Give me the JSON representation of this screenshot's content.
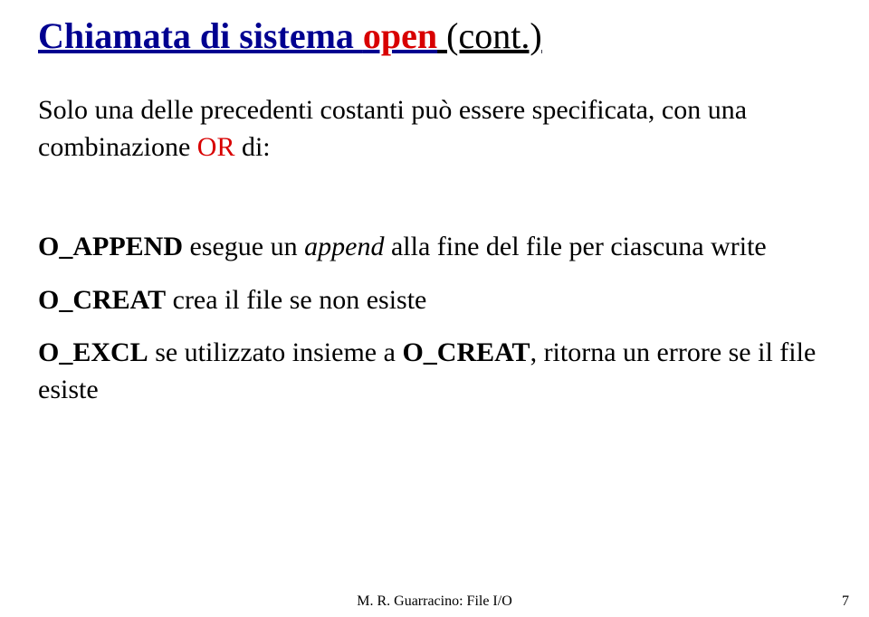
{
  "title": {
    "part1": "Chiamata di sistema ",
    "highlight": "open",
    "part2": " (cont.)"
  },
  "lead": {
    "t1": "Solo una delle precedenti costanti può essere specificata, con una combinazione ",
    "or": "OR",
    "t2": " di:"
  },
  "items": {
    "append": {
      "name": "O_APPEND",
      "t1": " esegue un ",
      "ital": "append",
      "t2": " alla fine del file per ciascuna write"
    },
    "creat": {
      "name": "O_CREAT",
      "t1": " crea il file se non esiste"
    },
    "excl": {
      "name": "O_EXCL",
      "t1": " se utilizzato insieme a ",
      "ref": "O_CREAT",
      "t2": ", ritorna un errore se il file esiste"
    }
  },
  "footer": "M. R. Guarracino: File I/O",
  "page": "7"
}
